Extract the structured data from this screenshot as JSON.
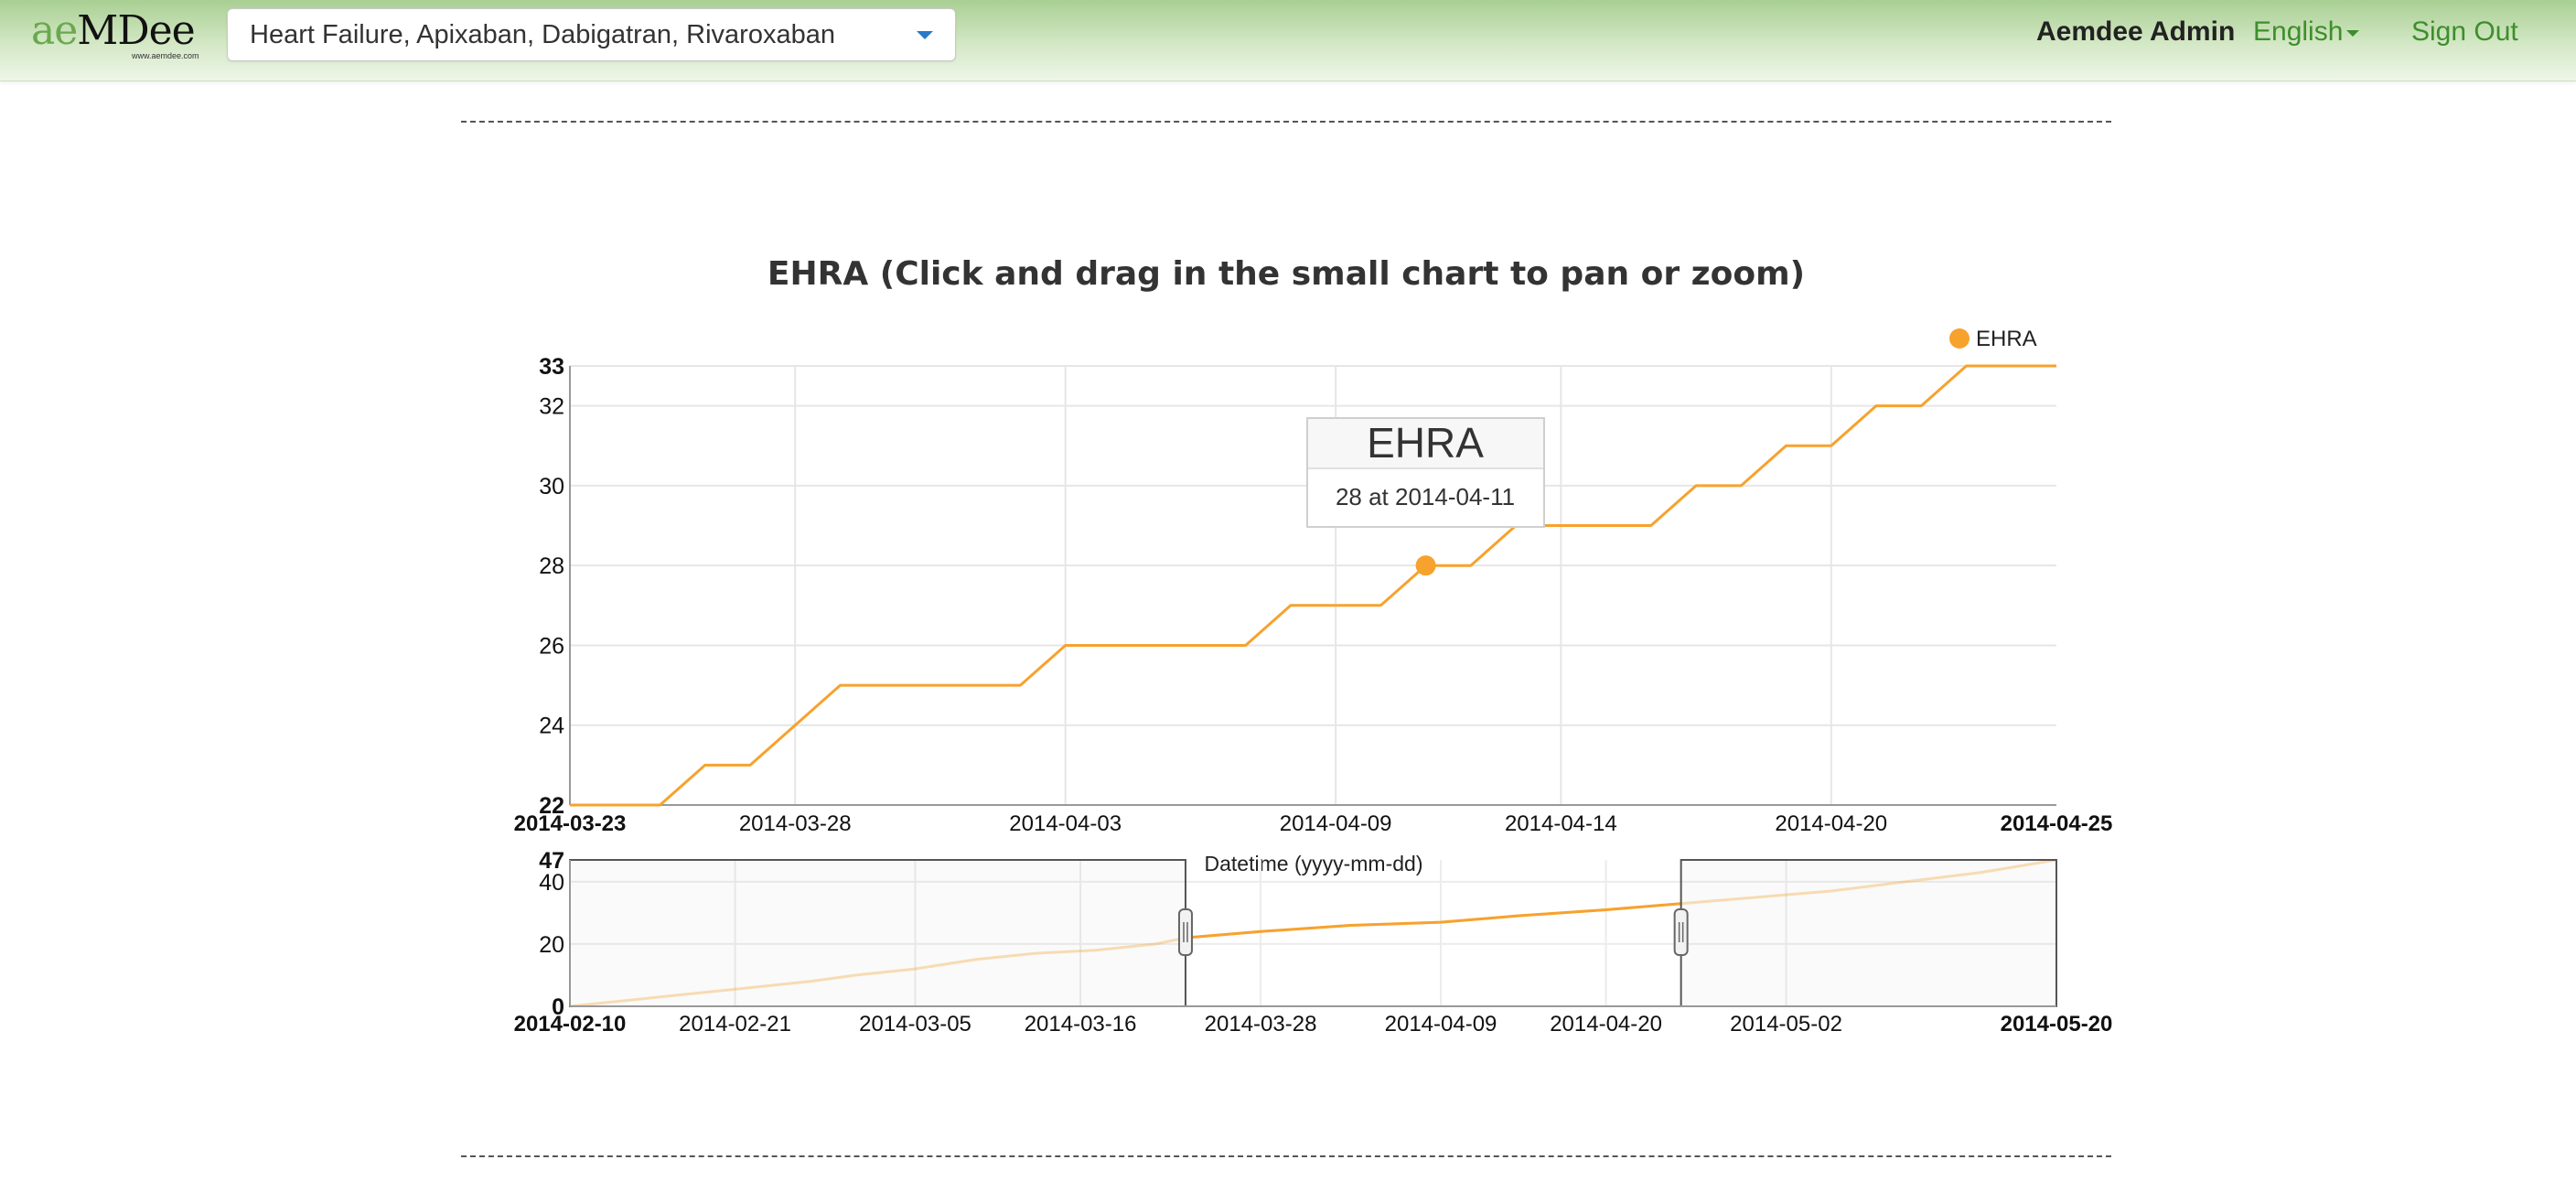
{
  "app": {
    "logo_text_ae": "ae",
    "logo_text_rest": "MDee",
    "logo_subtext": "www.aemdee.com",
    "selector_value": "Heart Failure, Apixaban, Dabigatran, Rivaroxaban",
    "user_name": "Aemdee Admin",
    "language": "English",
    "sign_out": "Sign Out"
  },
  "colors": {
    "series": "#f7a22d",
    "nav_link": "#3e8e2c",
    "selector_caret": "#2a78c8"
  },
  "tooltip": {
    "title": "EHRA",
    "body": "28 at 2014-04-11"
  },
  "chart_data": {
    "type": "line",
    "title": "EHRA (Click and drag in the small chart to pan or zoom)",
    "legend": {
      "position": "top-right",
      "entries": [
        "EHRA"
      ]
    },
    "xlabel": "Datetime (yyyy-mm-dd)",
    "ylabel": "",
    "grid": true,
    "main": {
      "xlim": [
        "2014-03-23",
        "2014-04-25"
      ],
      "ylim": [
        22,
        33
      ],
      "x_ticks": [
        "2014-03-23",
        "2014-03-28",
        "2014-04-03",
        "2014-04-09",
        "2014-04-14",
        "2014-04-20",
        "2014-04-25"
      ],
      "y_ticks": [
        22,
        24,
        26,
        28,
        30,
        32,
        33
      ],
      "series": [
        {
          "name": "EHRA",
          "x": [
            "2014-03-23",
            "2014-03-25",
            "2014-03-26",
            "2014-03-27",
            "2014-03-29",
            "2014-03-30",
            "2014-04-02",
            "2014-04-03",
            "2014-04-07",
            "2014-04-08",
            "2014-04-10",
            "2014-04-11",
            "2014-04-12",
            "2014-04-13",
            "2014-04-16",
            "2014-04-17",
            "2014-04-18",
            "2014-04-19",
            "2014-04-20",
            "2014-04-21",
            "2014-04-22",
            "2014-04-23",
            "2014-04-24",
            "2014-04-25"
          ],
          "y": [
            22,
            22,
            23,
            23,
            25,
            25,
            25,
            26,
            26,
            27,
            27,
            28,
            28,
            29,
            29,
            30,
            30,
            31,
            31,
            32,
            32,
            33,
            33,
            33
          ]
        }
      ],
      "highlight": {
        "x": "2014-04-11",
        "y": 28
      }
    },
    "navigator": {
      "xlim": [
        "2014-02-10",
        "2014-05-20"
      ],
      "ylim": [
        0,
        47
      ],
      "x_ticks": [
        "2014-02-10",
        "2014-02-21",
        "2014-03-05",
        "2014-03-16",
        "2014-03-28",
        "2014-04-09",
        "2014-04-20",
        "2014-05-02",
        "2014-05-20"
      ],
      "y_ticks": [
        0,
        20,
        40,
        47
      ],
      "selected_range": [
        "2014-03-23",
        "2014-04-25"
      ],
      "series": [
        {
          "name": "EHRA",
          "x": [
            "2014-02-10",
            "2014-02-14",
            "2014-02-18",
            "2014-02-22",
            "2014-02-26",
            "2014-03-01",
            "2014-03-05",
            "2014-03-09",
            "2014-03-13",
            "2014-03-17",
            "2014-03-21",
            "2014-03-23",
            "2014-03-28",
            "2014-04-03",
            "2014-04-09",
            "2014-04-14",
            "2014-04-20",
            "2014-04-25",
            "2014-04-30",
            "2014-05-05",
            "2014-05-10",
            "2014-05-15",
            "2014-05-20"
          ],
          "y": [
            0,
            2,
            4,
            6,
            8,
            10,
            12,
            15,
            17,
            18,
            20,
            22,
            24,
            26,
            27,
            29,
            31,
            33,
            35,
            37,
            40,
            43,
            47
          ]
        }
      ]
    }
  }
}
